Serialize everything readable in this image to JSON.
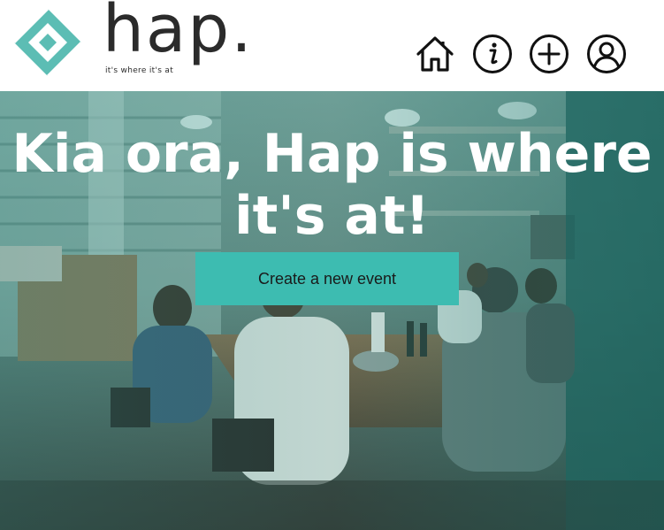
{
  "brand": {
    "name": "hap.",
    "tagline": "it's where it's at",
    "primary_color": "#3dbcb1",
    "logo_icon": "diamond-logo-icon"
  },
  "nav": {
    "items": [
      {
        "icon": "home-icon"
      },
      {
        "icon": "info-icon"
      },
      {
        "icon": "add-icon"
      },
      {
        "icon": "user-icon"
      }
    ]
  },
  "hero": {
    "title": "Kia ora, Hap is where it's at!",
    "cta_label": "Create a new event"
  }
}
